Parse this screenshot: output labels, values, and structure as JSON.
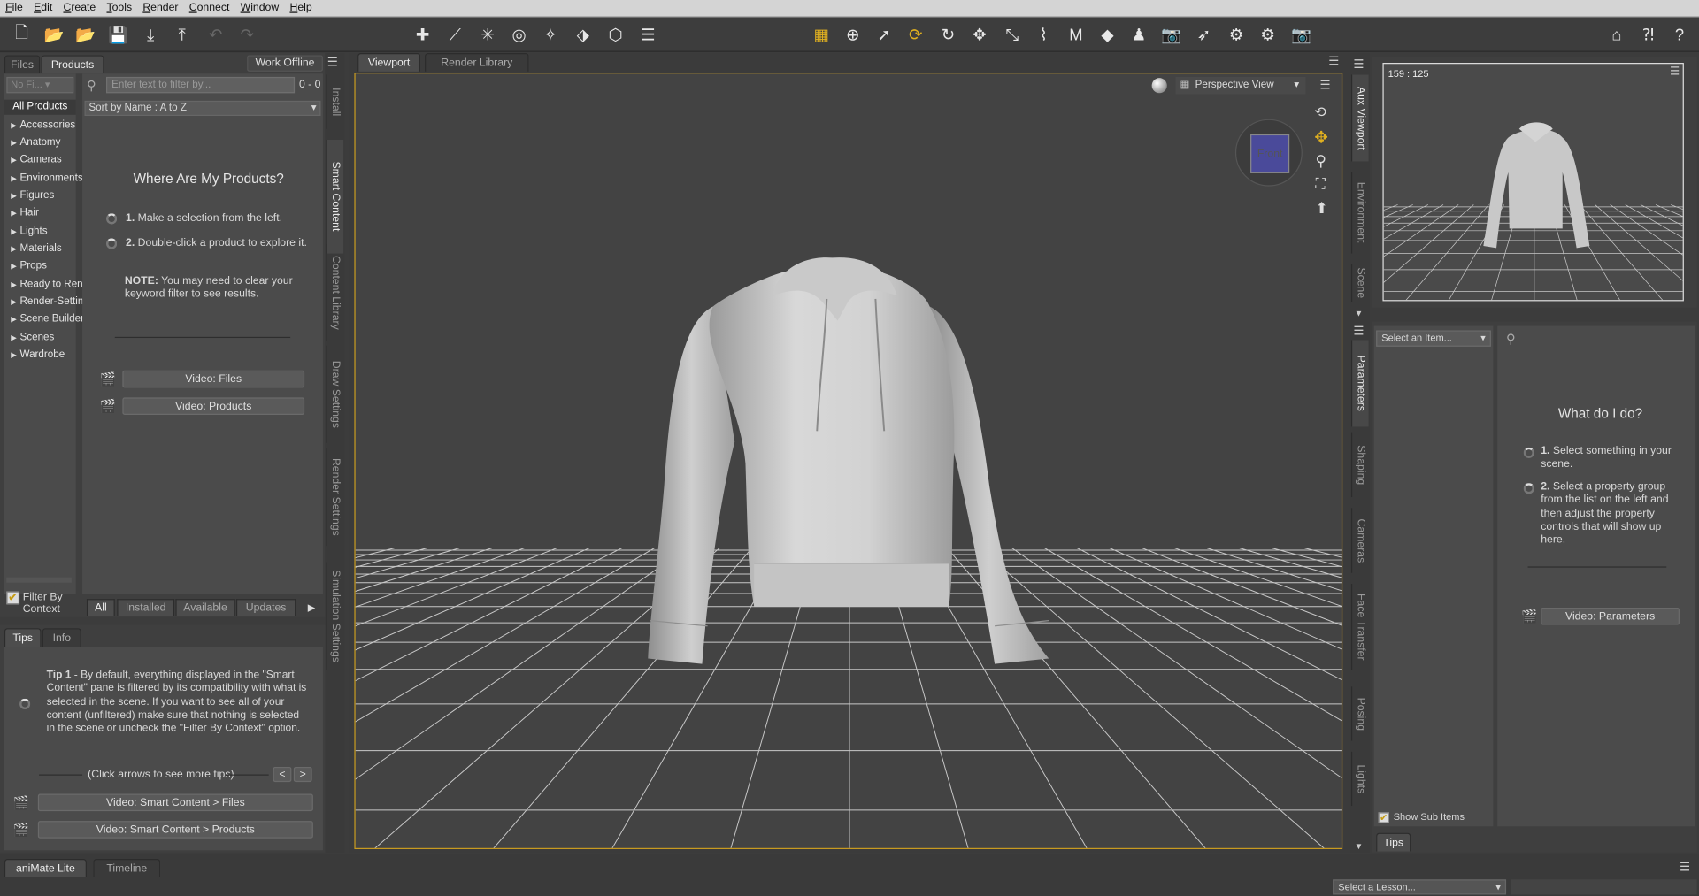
{
  "menu": [
    "File",
    "Edit",
    "Create",
    "Tools",
    "Render",
    "Connect",
    "Window",
    "Help"
  ],
  "toolbar_icons": [
    "new-file-icon",
    "open-icon",
    "merge-icon",
    "save-icon",
    "import-icon",
    "export-icon",
    "undo-icon",
    "redo-icon",
    "node-icon",
    "joint-editor-icon",
    "light-icon",
    "environment-icon",
    "spot-icon",
    "node-selection-icon",
    "geometry-icon",
    "menu-lines-icon",
    "grid-icon",
    "universal-icon",
    "select-icon",
    "rotate-orbit-icon",
    "rotate-icon",
    "translate-icon",
    "scale-icon",
    "bend-icon",
    "weight-icon",
    "surface-icon",
    "figure-icon",
    "camera-add-icon",
    "selection-arrow-icon",
    "gear-icon",
    "render-settings-icon",
    "render-camera-icon",
    "home-icon",
    "whats-this-icon",
    "help-icon"
  ],
  "left": {
    "tabs": [
      "Files",
      "Products"
    ],
    "work_offline": "Work Offline",
    "vendor_placeholder": "No Fi...",
    "filter_placeholder": "Enter text to filter by...",
    "count": "0 - 0",
    "sort": "Sort by Name : A to Z",
    "all_products": "All Products",
    "categories": [
      "Accessories",
      "Anatomy",
      "Cameras",
      "Environments",
      "Figures",
      "Hair",
      "Lights",
      "Materials",
      "Props",
      "Ready to Rend",
      "Render-Settin",
      "Scene Builder",
      "Scenes",
      "Wardrobe"
    ],
    "filter_by_context": "Filter By Context",
    "where_title": "Where Are My Products?",
    "step1_num": "1.",
    "step1": "Make a selection from the left.",
    "step2_num": "2.",
    "step2": "Double-click a product to explore it.",
    "note_label": "NOTE:",
    "note_text": "You may need to clear your keyword filter to see results.",
    "video_files": "Video: Files",
    "video_products": "Video: Products",
    "bottom_tabs": [
      "All",
      "Installed",
      "Available",
      "Updates"
    ],
    "side_tabs": [
      "Install",
      "Smart Content",
      "Content Library",
      "Draw Settings",
      "Render Settings",
      "Simulation Settings"
    ]
  },
  "tips": {
    "tabs": [
      "Tips",
      "Info"
    ],
    "tip_label": "Tip 1",
    "tip_text": " - By default, everything displayed in the \"Smart Content\" pane is filtered by its compatibility with what is selected in the scene. If you want to see all of your content (unfiltered) make sure that nothing is selected in the scene or uncheck the \"Filter By Context\" option.",
    "nav_hint": "(Click arrows to see more tips)",
    "prev": "<",
    "next": ">",
    "video_sc_files": "Video: Smart Content > Files",
    "video_sc_products": "Video: Smart Content > Products"
  },
  "viewport": {
    "tabs": [
      "Viewport",
      "Render Library"
    ],
    "view_menu": "Perspective View",
    "cube_label": "Front"
  },
  "right": {
    "aux_label": "159 : 125",
    "top_side_tabs": [
      "Aux Viewport",
      "Environment",
      "Scene"
    ],
    "side_tabs": [
      "Parameters",
      "Shaping",
      "Cameras",
      "Face Transfer",
      "Posing",
      "Lights"
    ],
    "select_item": "Select an Item...",
    "what_title": "What do I do?",
    "step1_num": "1.",
    "step1": "Select something in your scene.",
    "step2_num": "2.",
    "step2": "Select a property group from the list on the left and then adjust the property controls that will show up here.",
    "video_parameters": "Video: Parameters",
    "show_sub_items": "Show Sub Items",
    "tips_tab": "Tips"
  },
  "bottom": {
    "tabs": [
      "aniMate Lite",
      "Timeline"
    ],
    "lesson": "Select a Lesson..."
  },
  "colors": {
    "accent": "#e0b020",
    "panel": "#4a4a4a",
    "viewport_bg": "#434343",
    "cube": "#4a4a9a"
  }
}
